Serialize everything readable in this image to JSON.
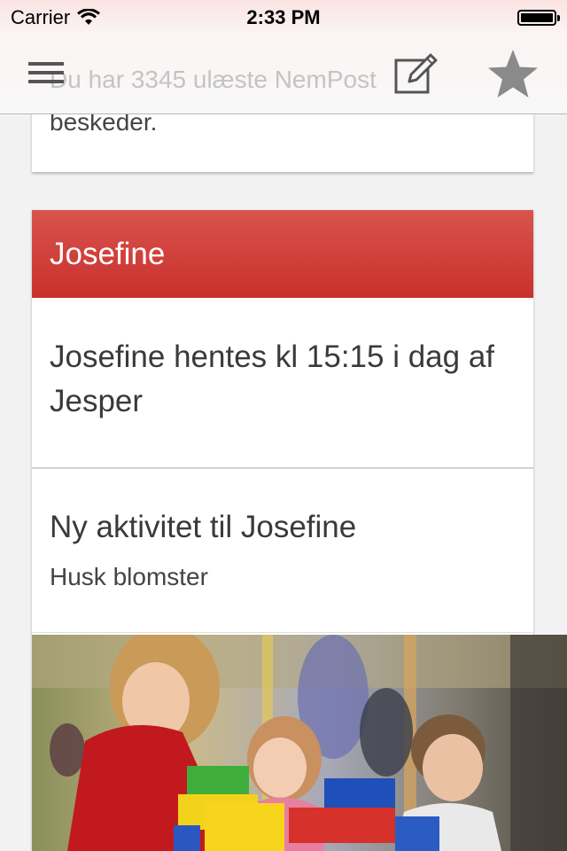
{
  "status_bar": {
    "carrier": "Carrier",
    "time": "2:33 PM"
  },
  "header": {
    "ghost_text": "Du har 3345 ulæste NemPost"
  },
  "top_card": {
    "text": "beskeder."
  },
  "card": {
    "title": "Josefine",
    "item1": {
      "text": "Josefine hentes kl 15:15 i dag af Jesper"
    },
    "item2": {
      "title": "Ny aktivitet til Josefine",
      "subtitle": "Husk blomster"
    }
  },
  "colors": {
    "card_header": "#d9534d",
    "background": "#f2f2f2",
    "icon_grey": "#8a8a8a"
  },
  "icons": [
    "wifi-icon",
    "battery-icon",
    "menu-icon",
    "compose-icon",
    "star-icon"
  ]
}
